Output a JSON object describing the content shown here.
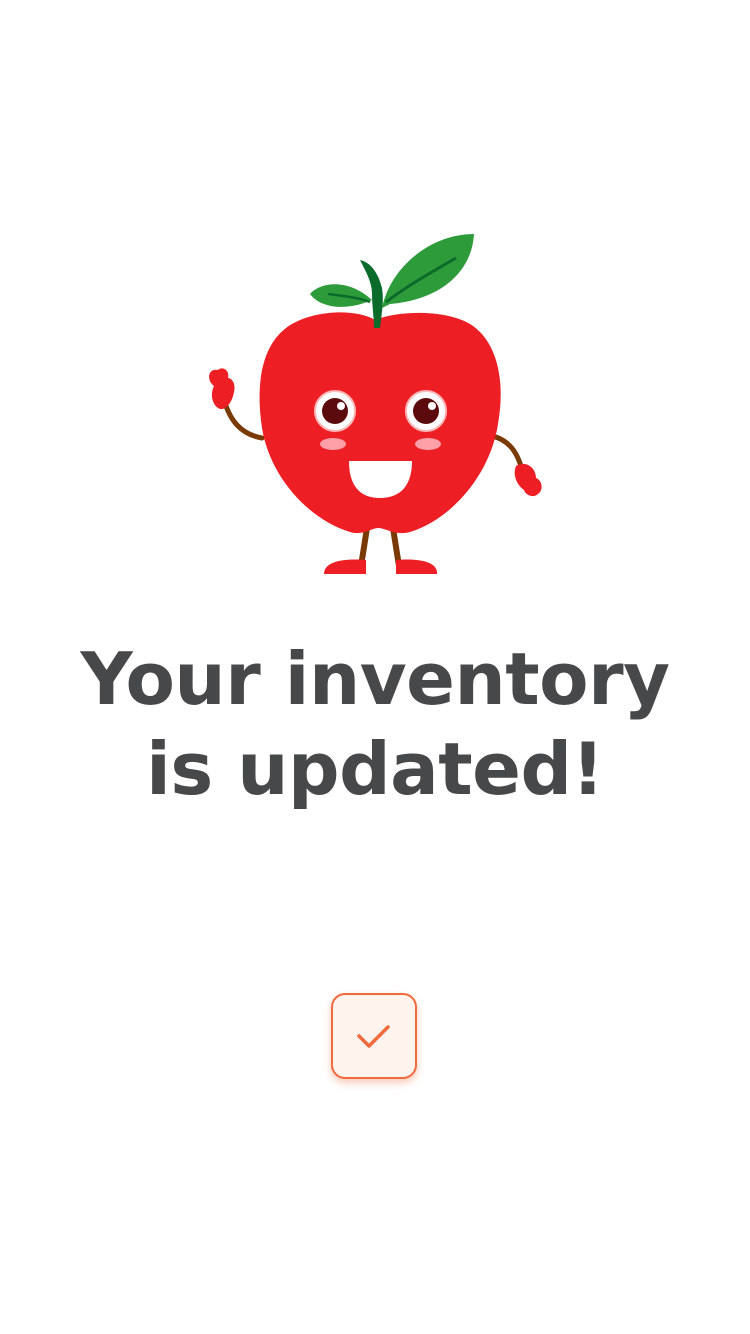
{
  "illustration": {
    "icon": "apple-mascot-icon",
    "colors": {
      "apple": "#ee1f24",
      "leaf": "#2e9b3a",
      "stem": "#0b6b2b",
      "limbs": "#7a3a05"
    }
  },
  "message": {
    "line1": "Your inventory",
    "line2": "is updated!"
  },
  "confirm_button": {
    "icon": "checkmark-icon",
    "accent_color": "#ef6a3c"
  }
}
